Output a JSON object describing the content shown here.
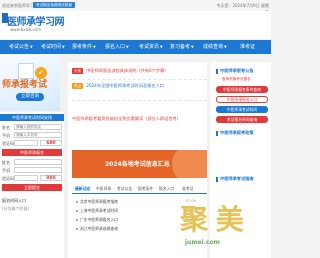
{
  "topbar": {
    "welcome": "欢迎来到医师学习网",
    "tag": "考试报名免费测试频道",
    "right": "今天是：2024年7月9日 星期二"
  },
  "header": {
    "logo_title": "医师承学习网",
    "logo_url": "www.bxlzk.com"
  },
  "nav": {
    "items": [
      {
        "label": "考试公告",
        "dd": "▼"
      },
      {
        "label": "考试时间",
        "dd": "▼"
      },
      {
        "label": "报考条件",
        "dd": "▼"
      },
      {
        "label": "报名入口",
        "dd": "▼"
      },
      {
        "label": "考试资讯",
        "dd": "▼"
      },
      {
        "label": "复习备考",
        "dd": "▼"
      },
      {
        "label": "成绩查询",
        "dd": "▼"
      },
      {
        "label": "准考证",
        "dd": ""
      }
    ]
  },
  "banner": {
    "headline": "师承报考试",
    "sub": "考试",
    "button": "立即咨询",
    "check_glyph": "✓"
  },
  "left_panel": {
    "heading": "中医师承考试时间安排",
    "name_label": "姓名",
    "name_placeholder": "请输入您的姓名",
    "phone_label": "手机",
    "phone_placeholder": "请输入手机号",
    "code_label": "验证码",
    "code_value": "680",
    "send_button": "中医师承报名",
    "name_label_2": "姓名",
    "phone_label_2": "手机",
    "code_label_2": "验证码",
    "code_value_2": "880",
    "submit_button": "立即提交",
    "bottom_1": "报名时间入口",
    "bottom_2": "(分为两个阶段)"
  },
  "news": {
    "rows": [
      {
        "badge": "头条",
        "badge_color": "#e4393c",
        "text": "中医师承报告流程具体说明（共有6个步骤）",
        "style": "head"
      },
      {
        "badge": "热点",
        "badge_color": "#f39a1e",
        "text": "2024年全国中医师承考试时间及报名入口",
        "style": "sub"
      },
      {
        "badge": "",
        "badge_color": "",
        "text": "中医师承报考要用各省份全免优惠解读（部分人群适合考）",
        "style": "sub"
      }
    ],
    "wide_banner_text": "2024各地考试信息汇总",
    "tabs": [
      "最新动态",
      "中医师承",
      "考试公告",
      "报考条件",
      "报名入口",
      "准考证"
    ],
    "list": [
      {
        "text": "北京中医师承报考指南",
        "date": "07-09"
      },
      {
        "text": "上海中医师承考试时间",
        "date": "07-09"
      },
      {
        "text": "广东中医师承报名入口",
        "date": "07-09"
      },
      {
        "text": "浙江中医师承成绩查询",
        "date": "07-09"
      }
    ]
  },
  "right_panel": {
    "title_1": "中医师承报考公告",
    "sub_1": "医师资格考试报名",
    "btn_red": "中医师承报考条件查询",
    "btn_ghost": "中医师承报名入口",
    "btn_blue": "中医师承考试时间",
    "btn_red_2": "考试报名时间查询",
    "title_2": "中医师承报考政策",
    "title_3": "中医师承考试指南"
  },
  "watermark": {
    "main": "聚 美",
    "sub": "jumei.com"
  }
}
